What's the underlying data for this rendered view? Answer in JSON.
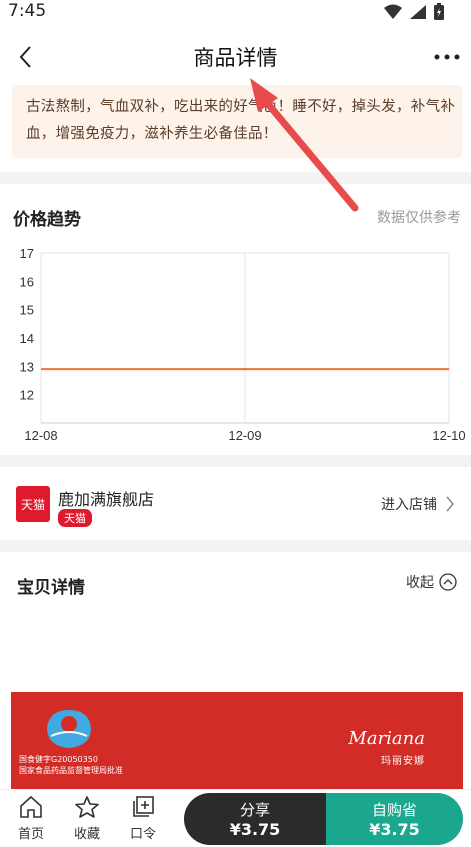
{
  "status_bar": {
    "time": "7:45"
  },
  "header": {
    "title": "商品详情"
  },
  "notice": {
    "text": "古法熬制，气血双补，吃出来的好气色！睡不好，掉头发，补气补血，增强免疫力，滋补养生必备佳品！"
  },
  "price_trend": {
    "title": "价格趋势",
    "hint": "数据仅供参考"
  },
  "chart_data": {
    "type": "line",
    "x": [
      "12-08",
      "12-09",
      "12-10"
    ],
    "series": [
      {
        "values": [
          12.9,
          12.9,
          12.9
        ]
      }
    ],
    "ylim": [
      11,
      17
    ],
    "yticks": [
      17,
      16,
      15,
      14,
      13,
      12
    ],
    "line_color": "#f07030",
    "grid": true
  },
  "store": {
    "name": "鹿加满旗舰店",
    "logo_text": "天猫",
    "badge": "天猫",
    "enter_label": "进入店铺"
  },
  "details": {
    "title": "宝贝详情",
    "collapse_label": "收起"
  },
  "banner": {
    "cert_line1": "国食健字G20050350",
    "cert_line2": "国家食品药品监督管理局批准",
    "brand_en": "Mariana",
    "brand_cn": "玛丽安娜"
  },
  "bottom_bar": {
    "nav": [
      {
        "label": "首页",
        "icon": "home-icon"
      },
      {
        "label": "收藏",
        "icon": "star-icon"
      },
      {
        "label": "口令",
        "icon": "command-icon"
      }
    ],
    "share": {
      "label": "分享",
      "price": "¥3.75"
    },
    "buy": {
      "label": "自购省",
      "price": "¥3.75"
    }
  },
  "colors": {
    "accent_green": "#1ba78d",
    "tmall_red": "#e01a2c",
    "arrow_red": "#e84b4b"
  }
}
